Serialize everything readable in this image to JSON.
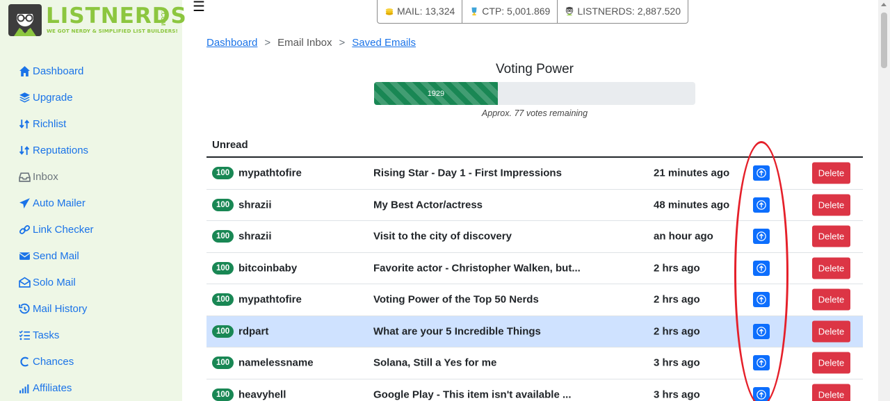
{
  "brand": {
    "name": "LISTNERDS",
    "tagline": "WE GOT NERDY & SIMPLIFIED LIST BUILDERS!",
    "domain_suffix": ".COM",
    "color": "#8cc63f"
  },
  "sidebar": {
    "items": [
      {
        "label": "Dashboard",
        "icon": "home-icon"
      },
      {
        "label": "Upgrade",
        "icon": "layers-icon"
      },
      {
        "label": "Richlist",
        "icon": "sort-icon"
      },
      {
        "label": "Reputations",
        "icon": "sort-icon"
      },
      {
        "label": "Inbox",
        "icon": "inbox-icon"
      },
      {
        "label": "Auto Mailer",
        "icon": "paper-plane-icon"
      },
      {
        "label": "Link Checker",
        "icon": "link-icon"
      },
      {
        "label": "Send Mail",
        "icon": "envelope-icon"
      },
      {
        "label": "Solo Mail",
        "icon": "envelope-open-icon"
      },
      {
        "label": "Mail History",
        "icon": "history-icon"
      },
      {
        "label": "Tasks",
        "icon": "tasks-icon"
      },
      {
        "label": "Chances",
        "icon": "c-icon"
      },
      {
        "label": "Affiliates",
        "icon": "signal-icon"
      }
    ]
  },
  "stats": {
    "mail": "MAIL: 13,324",
    "ctp": "CTP: 5,001.869",
    "listnerds": "LISTNERDS: 2,887.520"
  },
  "breadcrumb": {
    "dashboard": "Dashboard",
    "sep1": ">",
    "inbox": "Email Inbox",
    "sep2": ">",
    "saved": "Saved Emails"
  },
  "voting_power": {
    "title": "Voting Power",
    "value_label": "1929",
    "fill_fraction": 0.385,
    "note": "Approx. 77 votes remaining"
  },
  "table": {
    "header": "Unread",
    "delete_label": "Delete",
    "rows": [
      {
        "score": "100",
        "user": "mypathtofire",
        "subject": "Rising Star - Day 1 - First Impressions",
        "time": "21 minutes ago",
        "highlight": false
      },
      {
        "score": "100",
        "user": "shrazii",
        "subject": "My Best Actor/actress",
        "time": "48 minutes ago",
        "highlight": false
      },
      {
        "score": "100",
        "user": "shrazii",
        "subject": "Visit to the city of discovery",
        "time": "an hour ago",
        "highlight": false
      },
      {
        "score": "100",
        "user": "bitcoinbaby",
        "subject": "Favorite actor - Christopher Walken, but...",
        "time": "2 hrs ago",
        "highlight": false
      },
      {
        "score": "100",
        "user": "mypathtofire",
        "subject": "Voting Power of the Top 50 Nerds",
        "time": "2 hrs ago",
        "highlight": false
      },
      {
        "score": "100",
        "user": "rdpart",
        "subject": "What are your 5 Incredible Things",
        "time": "2 hrs ago",
        "highlight": true
      },
      {
        "score": "100",
        "user": "namelessname",
        "subject": "Solana, Still a Yes for me",
        "time": "3 hrs ago",
        "highlight": false
      },
      {
        "score": "100",
        "user": "heavyhell",
        "subject": "Google Play - This item isn't available ...",
        "time": "3 hrs ago",
        "highlight": false
      }
    ]
  },
  "colors": {
    "link": "#1a73e8",
    "sidebar_bg": "#eef7e6",
    "success": "#198754",
    "primary": "#0d6efd",
    "danger": "#dc3545",
    "highlight_row": "#cfe2ff",
    "annotation": "#e5202a"
  }
}
